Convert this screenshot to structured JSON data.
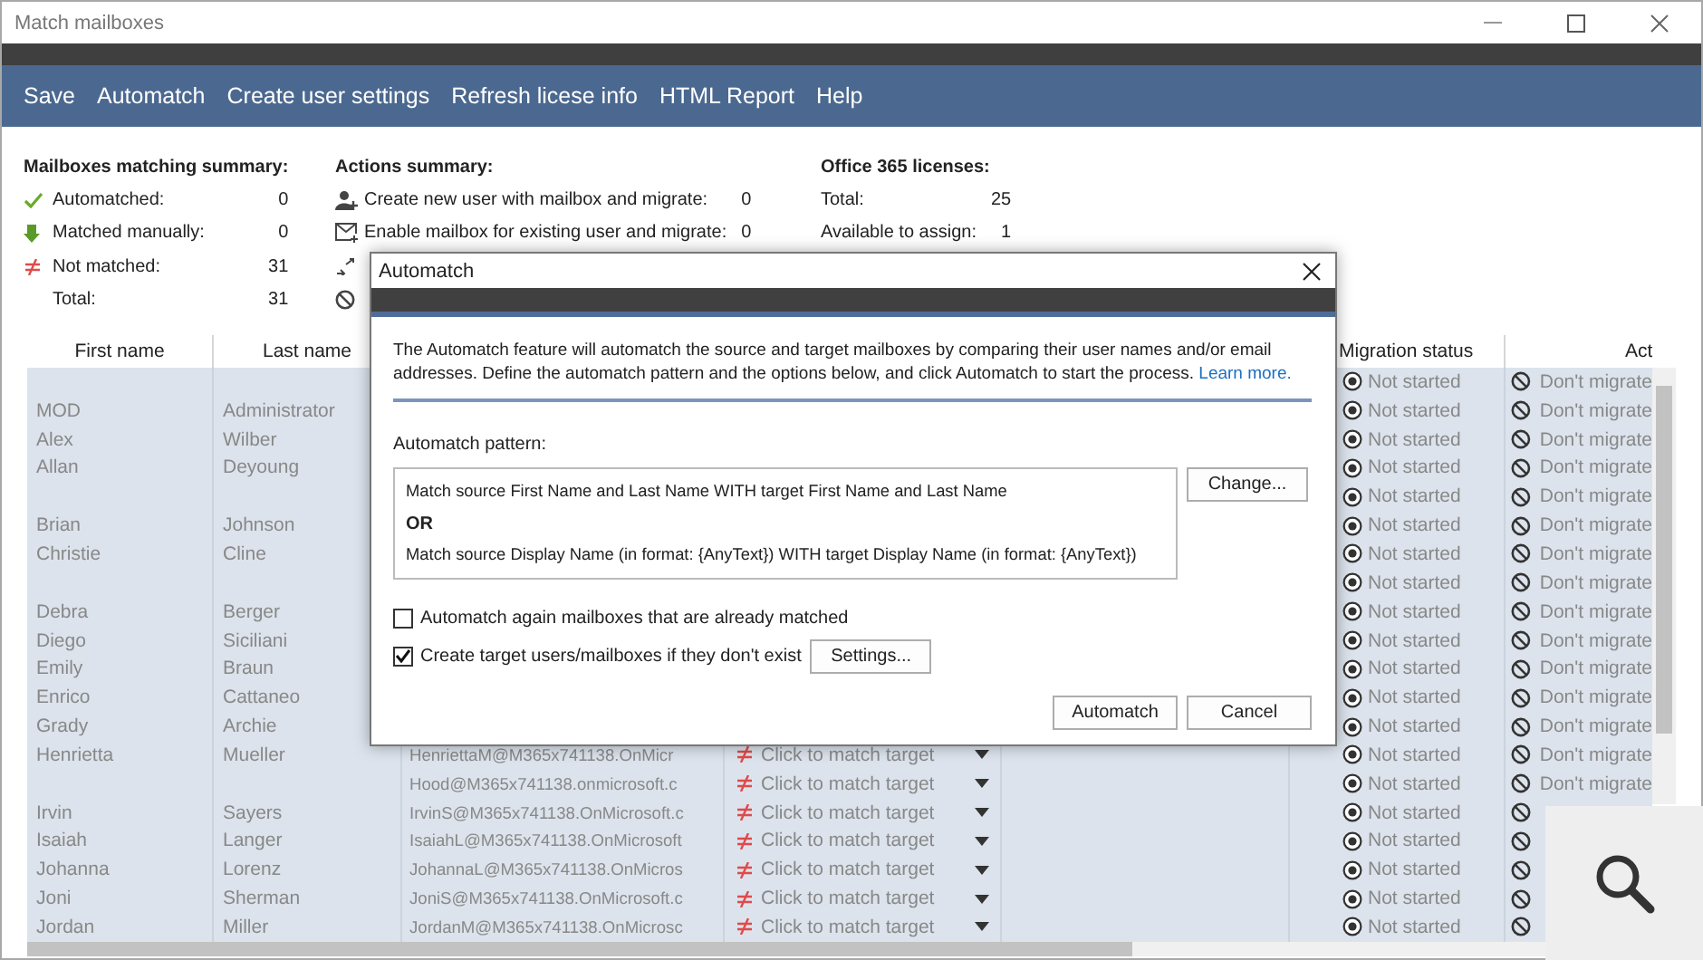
{
  "window": {
    "title": "Match mailboxes"
  },
  "menu": [
    "Save",
    "Automatch",
    "Create user settings",
    "Refresh licese info",
    "HTML Report",
    "Help"
  ],
  "summary": {
    "matching": {
      "title": "Mailboxes matching summary:",
      "items": [
        {
          "kind": "auto",
          "label": "Automatched:",
          "value": "0"
        },
        {
          "kind": "manual",
          "label": "Matched manually:",
          "value": "0"
        },
        {
          "kind": "unmatched",
          "label": "Not matched:",
          "value": "31"
        },
        {
          "kind": "total",
          "label": "Total:",
          "value": "31"
        }
      ]
    },
    "actions": {
      "title": "Actions summary:",
      "items": [
        {
          "kind": "create",
          "label": "Create new user with mailbox and migrate:",
          "value": "0"
        },
        {
          "kind": "enable",
          "label": "Enable mailbox for existing user and migrate:",
          "value": "0"
        },
        {
          "kind": "transfer"
        },
        {
          "kind": "skip"
        }
      ]
    },
    "licenses": {
      "title": "Office 365 licenses:",
      "items": [
        {
          "label": "Total:",
          "value": "25"
        },
        {
          "label": "Available to assign:",
          "value": "1"
        }
      ]
    }
  },
  "table": {
    "columns": {
      "first_name": "First name",
      "last_name": "Last name",
      "status": "Migration status",
      "action": "Act"
    },
    "rows": [
      {
        "status": "Not started",
        "action": "Don't migrate"
      },
      {
        "first_name": "MOD",
        "last_name": "Administrator",
        "status": "Not started",
        "action": "Don't migrate"
      },
      {
        "first_name": "Alex",
        "last_name": "Wilber",
        "status": "Not started",
        "action": "Don't migrate"
      },
      {
        "first_name": "Allan",
        "last_name": "Deyoung",
        "status": "Not started",
        "action": "Don't migrate"
      },
      {
        "status": "Not started",
        "action": "Don't migrate"
      },
      {
        "first_name": "Brian",
        "last_name": "Johnson",
        "status": "Not started",
        "action": "Don't migrate"
      },
      {
        "first_name": "Christie",
        "last_name": "Cline",
        "status": "Not started",
        "action": "Don't migrate"
      },
      {
        "status": "Not started",
        "action": "Don't migrate"
      },
      {
        "first_name": "Debra",
        "last_name": "Berger",
        "status": "Not started",
        "action": "Don't migrate"
      },
      {
        "first_name": "Diego",
        "last_name": "Siciliani",
        "status": "Not started",
        "action": "Don't migrate"
      },
      {
        "first_name": "Emily",
        "last_name": "Braun",
        "status": "Not started",
        "action": "Don't migrate"
      },
      {
        "first_name": "Enrico",
        "last_name": "Cattaneo",
        "status": "Not started",
        "action": "Don't migrate"
      },
      {
        "first_name": "Grady",
        "last_name": "Archie",
        "status": "Not started",
        "action": "Don't migrate"
      },
      {
        "first_name": "Henrietta",
        "last_name": "Mueller",
        "email": "HenriettaM@M365x741138.OnMicr",
        "target": "Click to match target",
        "status": "Not started",
        "action": "Don't migrate"
      },
      {
        "email": "Hood@M365x741138.onmicrosoft.c",
        "target": "Click to match target",
        "status": "Not started",
        "action": "Don't migrate"
      },
      {
        "first_name": "Irvin",
        "last_name": "Sayers",
        "email": "IrvinS@M365x741138.OnMicrosoft.c",
        "target": "Click to match target",
        "status": "Not started"
      },
      {
        "first_name": "Isaiah",
        "last_name": "Langer",
        "email": "IsaiahL@M365x741138.OnMicrosoft",
        "target": "Click to match target",
        "status": "Not started"
      },
      {
        "first_name": "Johanna",
        "last_name": "Lorenz",
        "email": "JohannaL@M365x741138.OnMicros",
        "target": "Click to match target",
        "status": "Not started"
      },
      {
        "first_name": "Joni",
        "last_name": "Sherman",
        "email": "JoniS@M365x741138.OnMicrosoft.c",
        "target": "Click to match target",
        "status": "Not started"
      },
      {
        "first_name": "Jordan",
        "last_name": "Miller",
        "email": "JordanM@M365x741138.OnMicrosc",
        "target": "Click to match target",
        "status": "Not started"
      }
    ]
  },
  "dialog": {
    "title": "Automatch",
    "description": "The Automatch feature will automatch the source and target mailboxes by comparing their user names and/or email addresses. Define the automatch pattern and the options below, and click Automatch to start the process.",
    "link": "Learn more.",
    "pattern_label": "Automatch pattern:",
    "pattern": [
      {
        "kind": "rule",
        "text": "Match source First Name and Last Name WITH target First Name and Last Name"
      },
      {
        "kind": "operator",
        "text": "OR"
      },
      {
        "kind": "rule",
        "text": "Match source Display Name (in format: {AnyText}) WITH target Display Name (in format: {AnyText})"
      }
    ],
    "change_button": "Change...",
    "options": [
      {
        "label": "Automatch again mailboxes that are already matched",
        "checked": false
      },
      {
        "label": "Create target users/mailboxes if they don't exist",
        "checked": true,
        "button": "Settings..."
      }
    ],
    "buttons": [
      "Automatch",
      "Cancel"
    ]
  }
}
